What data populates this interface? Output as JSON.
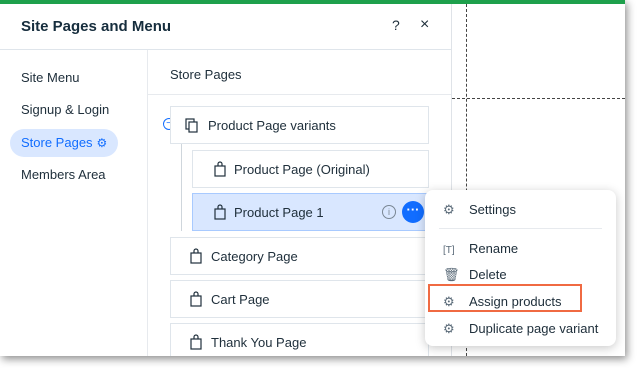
{
  "panel": {
    "title": "Site Pages and Menu",
    "help": "?",
    "close": "×"
  },
  "sidenav": {
    "items": [
      {
        "label": "Site Menu"
      },
      {
        "label": "Signup & Login"
      },
      {
        "label": "Store Pages",
        "selected": true
      },
      {
        "label": "Members Area"
      }
    ]
  },
  "content": {
    "section_title": "Store Pages",
    "pages": [
      {
        "label": "Product Page variants",
        "icon": "copy-pages-icon"
      },
      {
        "label": "Product Page (Original)",
        "icon": "shopping-bag-icon"
      },
      {
        "label": "Product Page 1",
        "icon": "shopping-bag-icon",
        "selected": true
      },
      {
        "label": "Category Page",
        "icon": "shopping-bag-icon"
      },
      {
        "label": "Cart Page",
        "icon": "shopping-bag-icon"
      },
      {
        "label": "Thank You Page",
        "icon": "shopping-bag-icon"
      }
    ],
    "more_label": "···",
    "info_label": "i"
  },
  "context_menu": {
    "items": [
      {
        "label": "Settings",
        "icon": "gear-icon"
      },
      {
        "label": "Rename",
        "icon": "rename-icon"
      },
      {
        "label": "Delete",
        "icon": "trash-icon"
      },
      {
        "label": "Assign products",
        "icon": "gear-icon",
        "highlighted": true
      },
      {
        "label": "Duplicate page variant",
        "icon": "gear-icon"
      }
    ]
  },
  "colors": {
    "accent": "#116dff",
    "selected_bg": "#d9e7ff",
    "top_bar": "#1ea04c",
    "highlight_border": "#f06a42"
  }
}
